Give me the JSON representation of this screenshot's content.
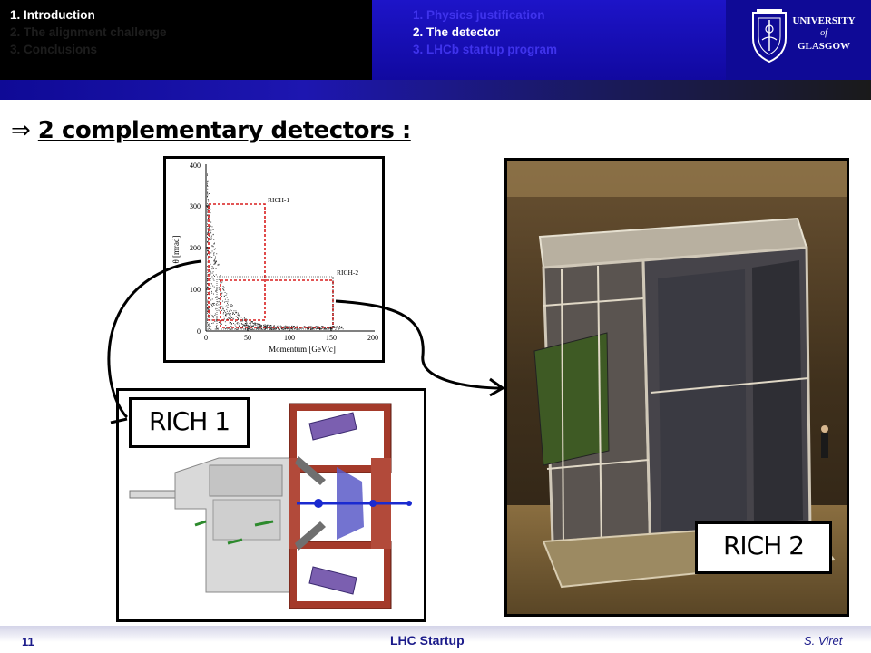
{
  "header": {
    "left_nav": [
      {
        "label": "1. Introduction",
        "active": true
      },
      {
        "label": "2. The alignment challenge",
        "active": false
      },
      {
        "label": "3. Conclusions",
        "active": false
      }
    ],
    "mid_nav": [
      {
        "label": "1. Physics justification",
        "active": false
      },
      {
        "label": "2. The detector",
        "active": true
      },
      {
        "label": "3. LHCb startup program",
        "active": false
      }
    ],
    "logo": {
      "line1": "UNIVERSITY",
      "line2": "of",
      "line3": "GLASGOW"
    }
  },
  "slide": {
    "bullet_arrow": "⇒",
    "bullet_text": "2 complementary detectors :",
    "label_rich1": "RICH 1",
    "label_rich2": "RICH 2"
  },
  "plot": {
    "ylabel": "θ [mrad]",
    "xlabel": "Momentum [GeV/c]",
    "rich1_label": "RICH-1",
    "rich2_label": "RICH-2",
    "x_ticks": [
      "0",
      "50",
      "100",
      "150",
      "200"
    ],
    "y_ticks": [
      "0",
      "100",
      "200",
      "300",
      "400"
    ]
  },
  "footer": {
    "page": "11",
    "title": "LHC Startup",
    "author": "S. Viret"
  },
  "colors": {
    "header_black": "#000000",
    "header_blue": "#1a12b8",
    "footer_text": "#1a1a8a",
    "dashed_red": "#d81e1e"
  }
}
